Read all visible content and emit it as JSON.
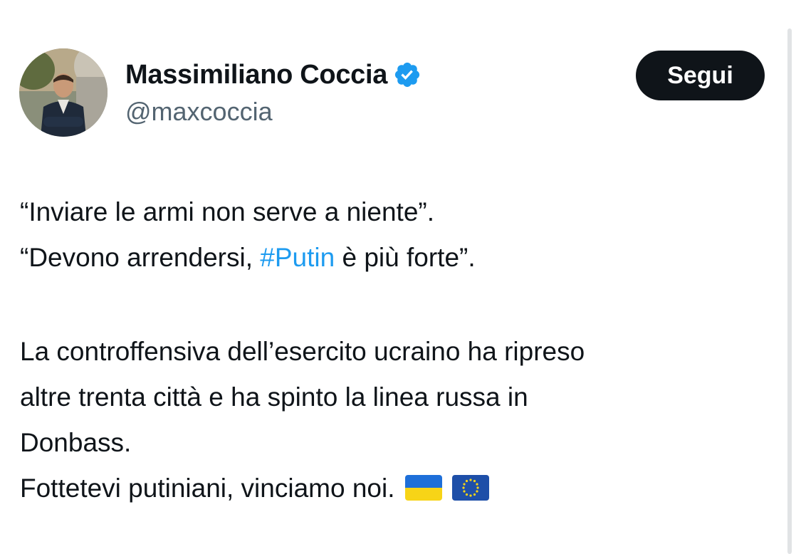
{
  "author": {
    "display_name": "Massimiliano Coccia",
    "handle": "@maxcoccia",
    "verified": true,
    "verified_color": "#1d9bf0"
  },
  "follow_button": {
    "label": "Segui"
  },
  "tweet": {
    "line1": "“Inviare le armi non serve a niente”.",
    "line2_before": "“Devono arrendersi, ",
    "line2_hashtag": "#Putin",
    "line2_after": " è più forte”.",
    "line3": "La controffensiva dell’esercito ucraino ha ripreso",
    "line4": "altre trenta città e ha spinto la linea russa in",
    "line5": "Donbass.",
    "line6": "Fottetevi putiniani, vinciamo noi.",
    "emojis": [
      "ukraine-flag",
      "eu-flag"
    ]
  },
  "colors": {
    "text": "#0f1419",
    "secondary_text": "#536471",
    "hashtag": "#1d9bf0",
    "highlight": "#fde126",
    "button_bg": "#0f1419"
  }
}
